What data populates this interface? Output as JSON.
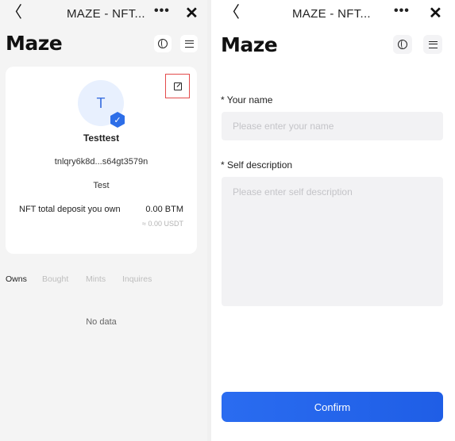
{
  "browser": {
    "title": "MAZE - NFT...",
    "back_icon": "chevron-left-icon",
    "more_label": "•••",
    "close_label": "✕"
  },
  "app": {
    "logo": "Maze"
  },
  "profile": {
    "avatar_initial": "T",
    "username": "Testtest",
    "address": "tnlqry6k8d...s64gt3579n",
    "description": "Test",
    "deposit_label": "NFT total deposit you own",
    "deposit_value": "0.00 BTM",
    "deposit_usdt": "≈ 0.00 USDT"
  },
  "tabs": [
    {
      "label": "Owns",
      "active": true
    },
    {
      "label": "Bought",
      "active": false
    },
    {
      "label": "Mints",
      "active": false
    },
    {
      "label": "Inquires",
      "active": false
    }
  ],
  "empty_text": "No data",
  "form": {
    "name_label": "* Your name",
    "name_placeholder": "Please enter your name",
    "desc_label": "* Self description",
    "desc_placeholder": "Please enter self description",
    "confirm_label": "Confirm"
  },
  "colors": {
    "accent": "#2a6cf0",
    "highlight_border": "#e34b4b",
    "avatar_bg": "#e8f0fe"
  }
}
